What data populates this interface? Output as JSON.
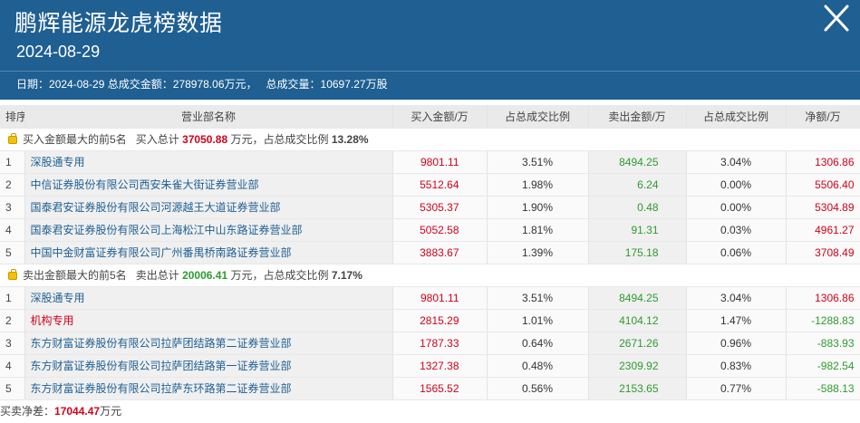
{
  "header": {
    "title": "鹏辉能源龙虎榜数据",
    "date": "2024-08-29",
    "summary_date_label": "日期：",
    "summary_date": "2024-08-29",
    "turnover_label": "总成交金额：",
    "turnover": "278978.06万元，",
    "volume_label": "总成交量：",
    "volume": "10697.27万股"
  },
  "columns": [
    "排序",
    "营业部名称",
    "买入金额/万",
    "占总成交比例",
    "卖出金额/万",
    "占总成交比例",
    "净额/万"
  ],
  "buy_section": {
    "title": "买入金额最大的前5名",
    "total_label": "买入总计",
    "total": "37050.88",
    "unit": "万元，",
    "ratio_label": "占总成交比例",
    "ratio": "13.28%",
    "rows": [
      {
        "rank": "1",
        "name": "深股通专用",
        "buy": "9801.11",
        "buy_pct": "3.51%",
        "sell": "8494.25",
        "sell_pct": "3.04%",
        "net": "1306.86"
      },
      {
        "rank": "2",
        "name": "中信证券股份有限公司西安朱雀大街证券营业部",
        "buy": "5512.64",
        "buy_pct": "1.98%",
        "sell": "6.24",
        "sell_pct": "0.00%",
        "net": "5506.40"
      },
      {
        "rank": "3",
        "name": "国泰君安证券股份有限公司河源越王大道证券营业部",
        "buy": "5305.37",
        "buy_pct": "1.90%",
        "sell": "0.48",
        "sell_pct": "0.00%",
        "net": "5304.89"
      },
      {
        "rank": "4",
        "name": "国泰君安证券股份有限公司上海松江中山东路证券营业部",
        "buy": "5052.58",
        "buy_pct": "1.81%",
        "sell": "91.31",
        "sell_pct": "0.03%",
        "net": "4961.27"
      },
      {
        "rank": "5",
        "name": "中国中金财富证券有限公司广州番禺桥南路证券营业部",
        "buy": "3883.67",
        "buy_pct": "1.39%",
        "sell": "175.18",
        "sell_pct": "0.06%",
        "net": "3708.49"
      }
    ]
  },
  "sell_section": {
    "title": "卖出金额最大的前5名",
    "total_label": "卖出总计",
    "total": "20006.41",
    "unit": "万元，",
    "ratio_label": "占总成交比例",
    "ratio": "7.17%",
    "rows": [
      {
        "rank": "1",
        "name": "深股通专用",
        "buy": "9801.11",
        "buy_pct": "3.51%",
        "sell": "8494.25",
        "sell_pct": "3.04%",
        "net": "1306.86"
      },
      {
        "rank": "2",
        "name": "机构专用",
        "buy": "2815.29",
        "buy_pct": "1.01%",
        "sell": "4104.12",
        "sell_pct": "1.47%",
        "net": "-1288.83"
      },
      {
        "rank": "3",
        "name": "东方财富证券股份有限公司拉萨团结路第二证券营业部",
        "buy": "1787.33",
        "buy_pct": "0.64%",
        "sell": "2671.26",
        "sell_pct": "0.96%",
        "net": "-883.93"
      },
      {
        "rank": "4",
        "name": "东方财富证券股份有限公司拉萨团结路第一证券营业部",
        "buy": "1327.38",
        "buy_pct": "0.48%",
        "sell": "2309.92",
        "sell_pct": "0.83%",
        "net": "-982.54"
      },
      {
        "rank": "5",
        "name": "东方财富证券股份有限公司拉萨东环路第二证券营业部",
        "buy": "1565.52",
        "buy_pct": "0.56%",
        "sell": "2153.65",
        "sell_pct": "0.77%",
        "net": "-588.13"
      }
    ]
  },
  "footer": {
    "label": "买卖净差：",
    "value": "17044.47",
    "unit": "万元"
  },
  "colors": {
    "header_bg": "#1f5f92",
    "up": "#d0021b",
    "down": "#2e9b2e"
  },
  "icons": {
    "close": "close-icon",
    "section": "money-bag-icon"
  }
}
